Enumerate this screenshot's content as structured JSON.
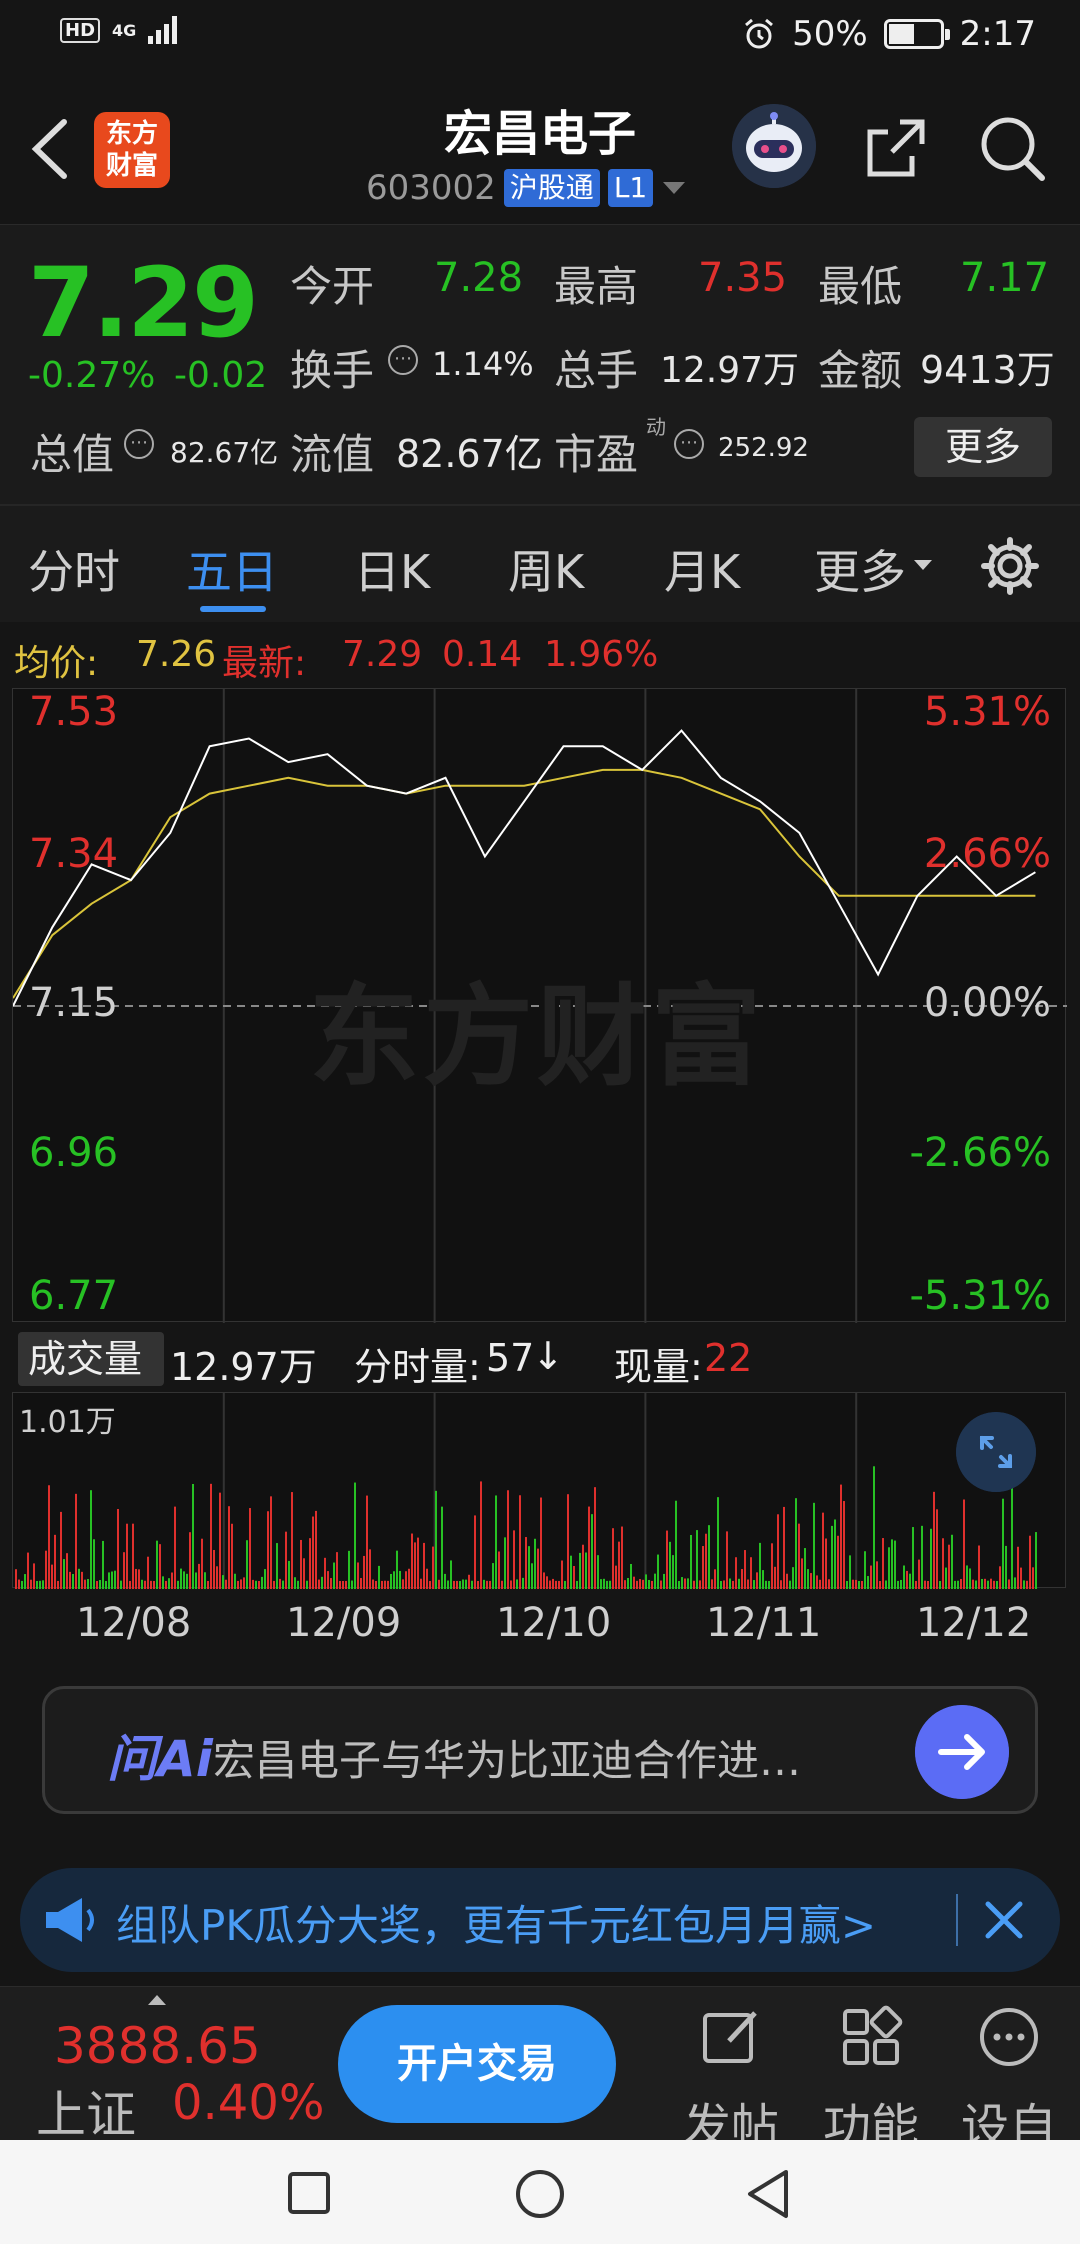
{
  "status_bar": {
    "hd": "HD",
    "net": "4G",
    "battery_pct": "50%",
    "battery_level": 0.5,
    "time": "2:17"
  },
  "header": {
    "app_logo_text": "东方财富",
    "title": "宏昌电子",
    "code": "603002",
    "tag_connect": "沪股通",
    "tag_level": "L1"
  },
  "quote": {
    "price": "7.29",
    "change_pct": "-0.27%",
    "change": "-0.02",
    "open_label": "今开",
    "open": "7.28",
    "high_label": "最高",
    "high": "7.35",
    "low_label": "最低",
    "low": "7.17",
    "turnover_label": "换手",
    "turnover": "1.14%",
    "volume_label": "总手",
    "volume": "12.97万",
    "amount_label": "金额",
    "amount": "9413万",
    "mcap_label": "总值",
    "mcap": "82.67亿",
    "float_label": "流值",
    "float_mcap": "82.67亿",
    "pe_label": "市盈",
    "pe_sup": "动",
    "pe": "252.92",
    "more_label": "更多"
  },
  "tabs": [
    "分时",
    "五日",
    "日K",
    "周K",
    "月K",
    "更多"
  ],
  "active_tab": 1,
  "chart_header": {
    "avg_label": "均价:",
    "avg": "7.26",
    "latest_label": "最新:",
    "latest": "7.29",
    "latest_chg": "0.14",
    "latest_pct": "1.96%"
  },
  "watermark": "东方财富",
  "chart_data": {
    "type": "line",
    "x": [
      "12/08",
      "12/09",
      "12/10",
      "12/11",
      "12/12"
    ],
    "ylim": [
      6.77,
      7.53
    ],
    "y_ticks_left": [
      "7.53",
      "7.34",
      "7.15",
      "6.96",
      "6.77"
    ],
    "y_ticks_right": [
      "5.31%",
      "2.66%",
      "0.00%",
      "-2.66%",
      "-5.31%"
    ],
    "base_price": 7.15,
    "series": [
      {
        "values": [
          7.15,
          7.25,
          7.33,
          7.31,
          7.37,
          7.48,
          7.49,
          7.46,
          7.47,
          7.43,
          7.42,
          7.44,
          7.34,
          7.41,
          7.48,
          7.48,
          7.45,
          7.5,
          7.44,
          7.41,
          7.37,
          7.28,
          7.19,
          7.29,
          7.34,
          7.29,
          7.32
        ]
      },
      {
        "values": [
          7.16,
          7.24,
          7.28,
          7.31,
          7.39,
          7.42,
          7.43,
          7.44,
          7.43,
          7.43,
          7.42,
          7.43,
          7.43,
          7.43,
          7.44,
          7.45,
          7.45,
          7.44,
          7.42,
          7.4,
          7.34,
          7.29,
          7.29,
          7.29,
          7.29,
          7.29,
          7.29
        ]
      }
    ]
  },
  "volume": {
    "label": "成交量",
    "total": "12.97万",
    "minute_label": "分时量:",
    "minute": "57",
    "current_label": "现量:",
    "current": "22",
    "max_label": "1.01万"
  },
  "ai": {
    "logo": "问Ai",
    "query": "宏昌电子与华为比亚迪合作进…"
  },
  "banner": {
    "text": "组队PK瓜分大奖，更有千元红包月月赢>"
  },
  "bottom": {
    "index_value": "3888.65",
    "index_name": "上证",
    "index_pct": "0.40%",
    "trade_label": "开户交易",
    "post_label": "发帖",
    "func_label": "功能",
    "settings_label": "设自"
  },
  "colors": {
    "up": "#e0302d",
    "down": "#27c124",
    "accent": "#3d8ff0",
    "avg": "#d9c43a"
  }
}
